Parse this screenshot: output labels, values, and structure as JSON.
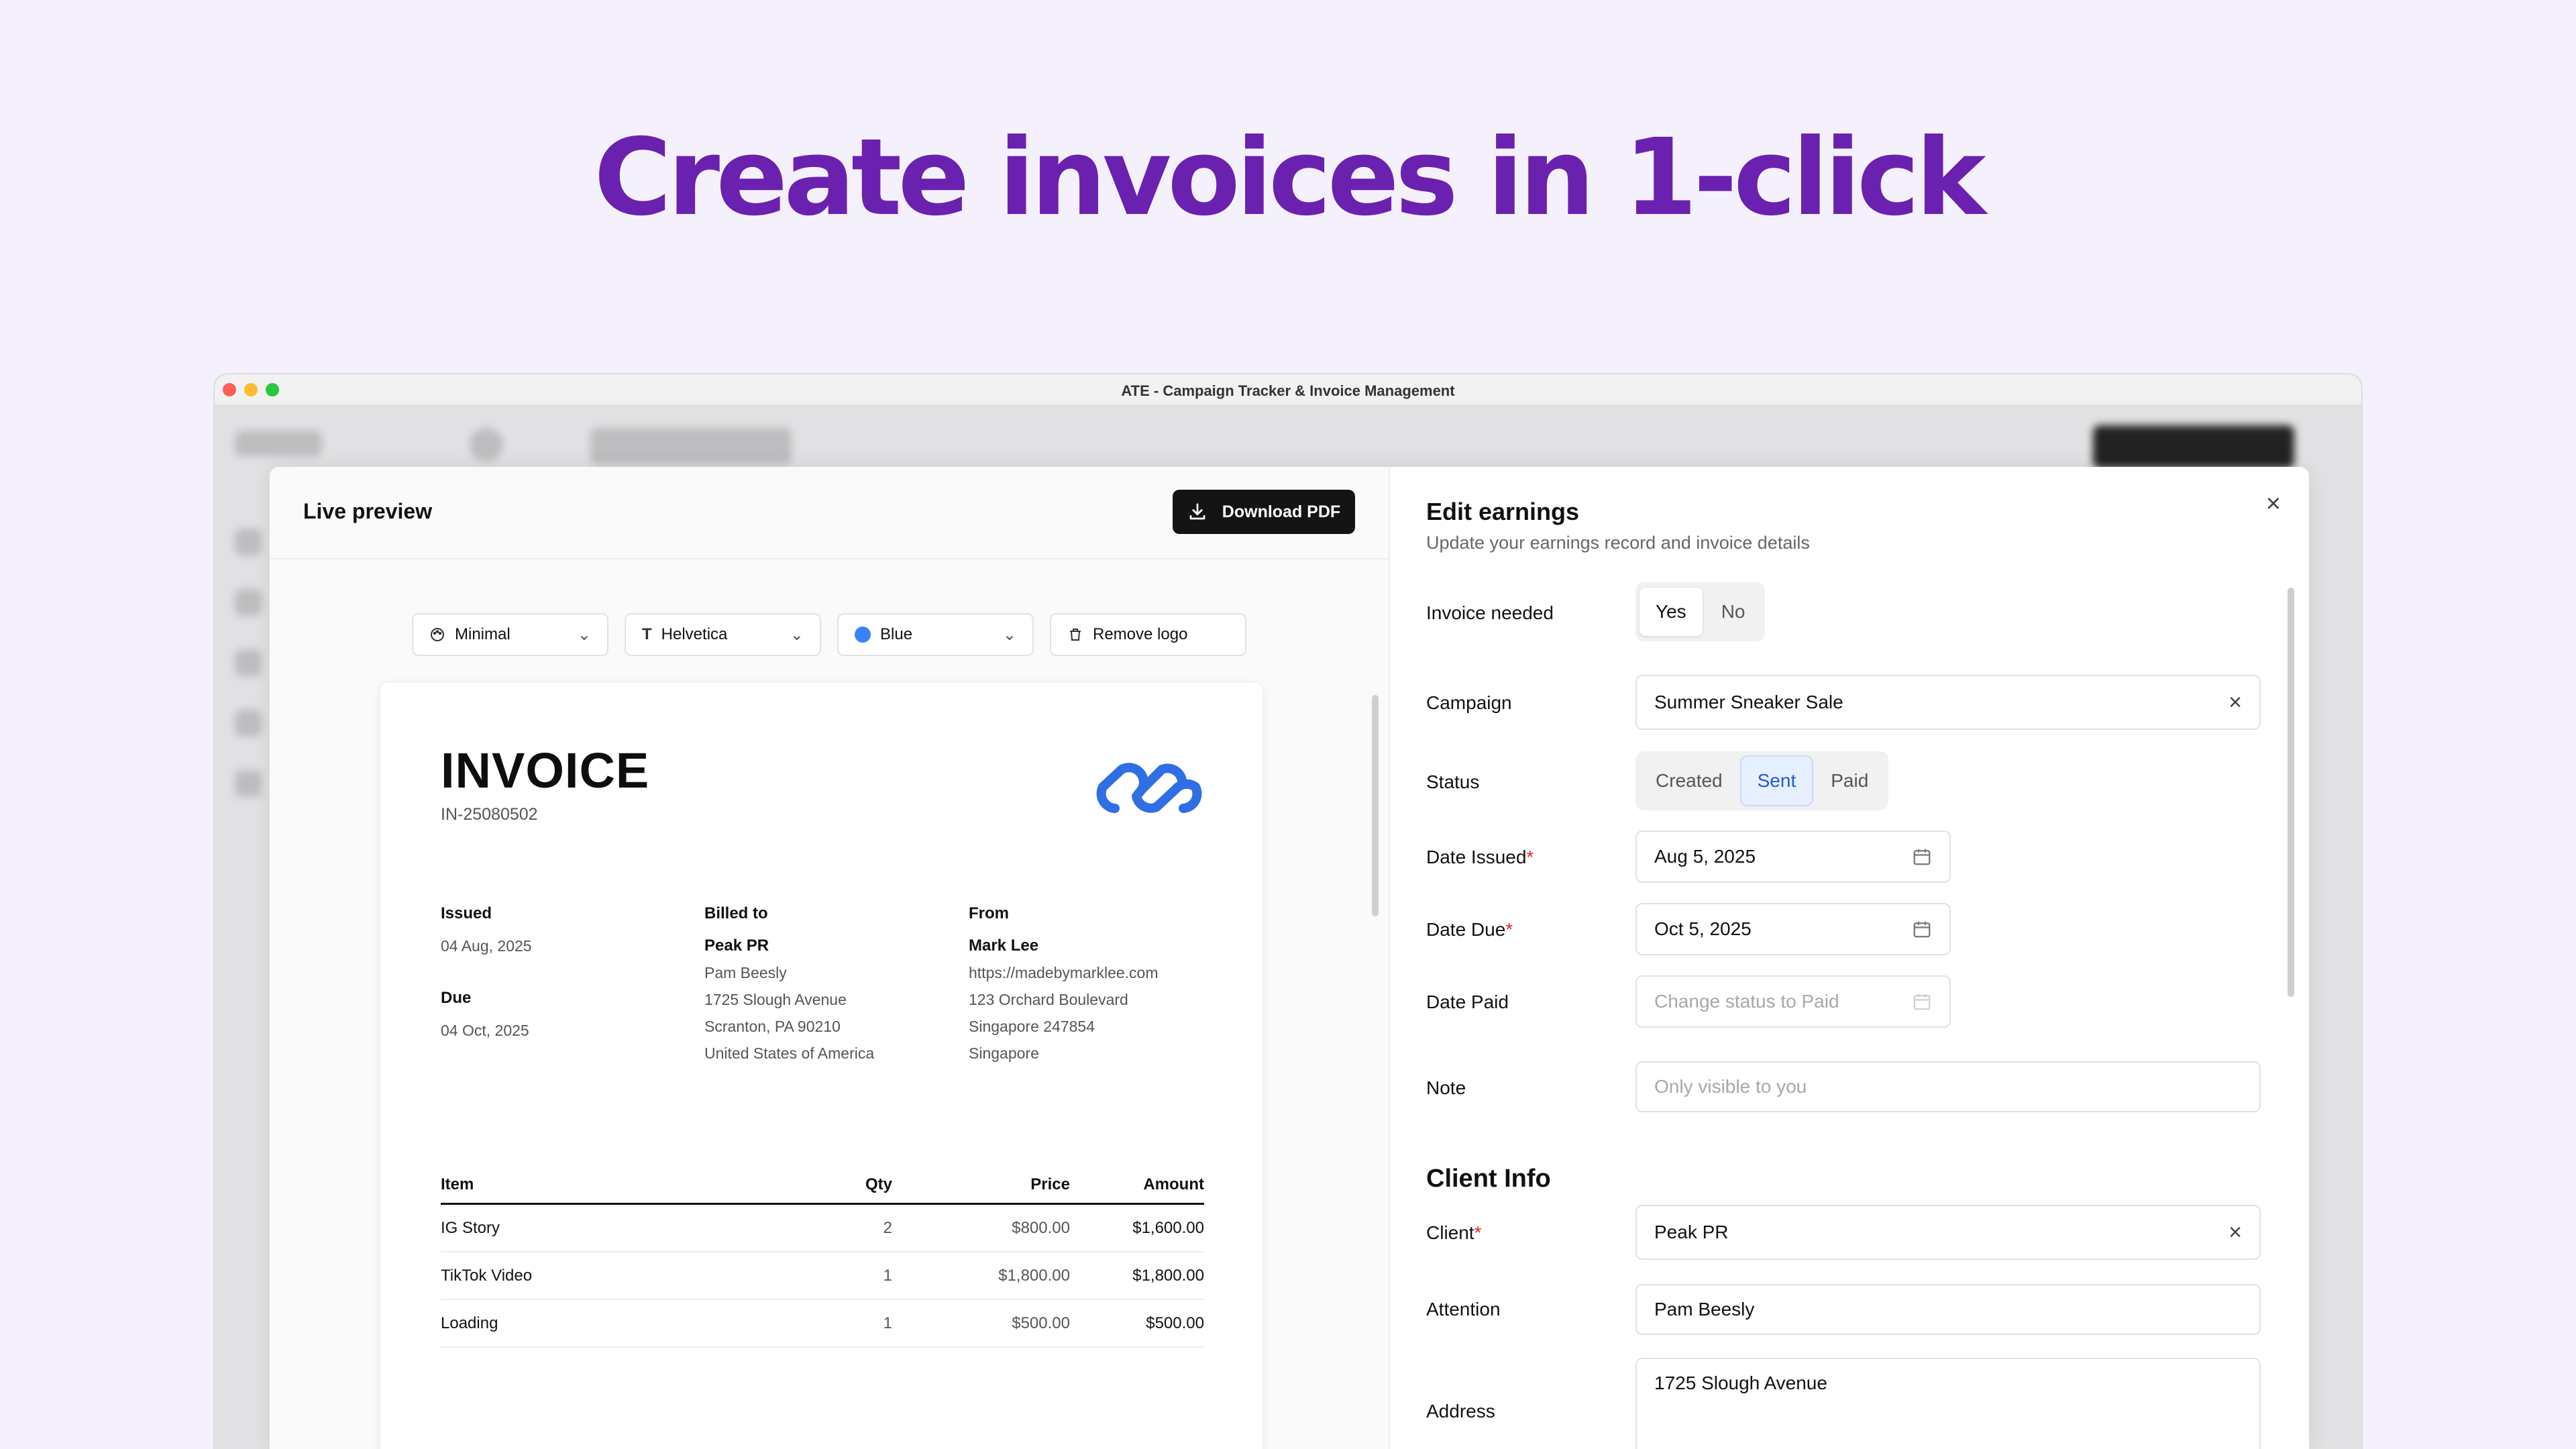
{
  "headline": "Create invoices in 1-click",
  "window": {
    "title": "ATE - Campaign Tracker & Invoice Management",
    "lights": [
      "#fe5f57",
      "#febc2e",
      "#28c840"
    ]
  },
  "preview": {
    "title": "Live preview",
    "download_label": "Download PDF",
    "template": "Minimal",
    "font": "Helvetica",
    "color_label": "Blue",
    "color_hex": "#3b82f6",
    "remove_logo_label": "Remove logo"
  },
  "invoice": {
    "title": "INVOICE",
    "number": "IN-25080502",
    "issued_label": "Issued",
    "issued_date": "04 Aug, 2025",
    "due_label": "Due",
    "due_date": "04 Oct, 2025",
    "billed_label": "Billed to",
    "billed": {
      "name": "Peak PR",
      "lines": [
        "Pam Beesly",
        "1725 Slough Avenue",
        "Scranton, PA 90210",
        "United States of America"
      ]
    },
    "from_label": "From",
    "from": {
      "name": "Mark Lee",
      "lines": [
        "https://madebymarklee.com",
        "123 Orchard Boulevard",
        "Singapore 247854",
        "Singapore"
      ]
    },
    "columns": [
      "Item",
      "Qty",
      "Price",
      "Amount"
    ],
    "items": [
      {
        "item": "IG Story",
        "qty": "2",
        "price": "$800.00",
        "amount": "$1,600.00"
      },
      {
        "item": "TikTok Video",
        "qty": "1",
        "price": "$1,800.00",
        "amount": "$1,800.00"
      },
      {
        "item": "Loading",
        "qty": "1",
        "price": "$500.00",
        "amount": "$500.00"
      }
    ]
  },
  "edit": {
    "title": "Edit earnings",
    "subtitle": "Update your earnings record and invoice details",
    "invoice_needed_label": "Invoice needed",
    "invoice_yes": "Yes",
    "invoice_no": "No",
    "campaign_label": "Campaign",
    "campaign_value": "Summer Sneaker Sale",
    "status_label": "Status",
    "status_options": [
      "Created",
      "Sent",
      "Paid"
    ],
    "status_selected": "Sent",
    "date_issued_label": "Date Issued",
    "date_issued_value": "Aug 5, 2025",
    "date_due_label": "Date Due",
    "date_due_value": "Oct 5, 2025",
    "date_paid_label": "Date Paid",
    "date_paid_placeholder": "Change status to Paid",
    "note_label": "Note",
    "note_placeholder": "Only visible to you",
    "client_section": "Client Info",
    "client_label": "Client",
    "client_value": "Peak PR",
    "attention_label": "Attention",
    "attention_value": "Pam Beesly",
    "address_label": "Address",
    "address_value": "1725 Slough Avenue"
  }
}
